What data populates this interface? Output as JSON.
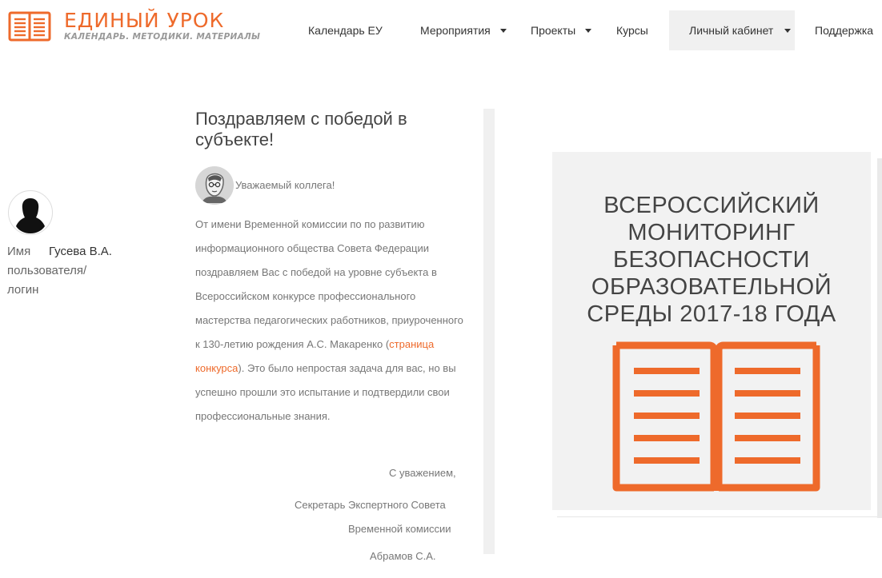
{
  "colors": {
    "accent": "#ee6a2b",
    "nav_active_bg": "#f0f0f0",
    "banner_bg": "#f2f2f2"
  },
  "header": {
    "logo": {
      "title": "ЕДИНЫЙ УРОК",
      "subtitle": "КАЛЕНДАРЬ. МЕТОДИКИ. МАТЕРИАЛЫ",
      "icon": "book-icon"
    },
    "nav": [
      {
        "label": "Календарь ЕУ",
        "dropdown": false
      },
      {
        "label": "Мероприятия",
        "dropdown": true
      },
      {
        "label": "Проекты",
        "dropdown": true
      },
      {
        "label": "Курсы",
        "dropdown": false
      },
      {
        "label": "Личный кабинет",
        "dropdown": true,
        "active": true
      },
      {
        "label": "Поддержка",
        "dropdown": false
      }
    ]
  },
  "user": {
    "avatar_icon": "user-silhouette-icon",
    "label": "Имя пользователя/ логин",
    "value": "Гусева В.А."
  },
  "article": {
    "title": "Поздравляем с победой в субъекте!",
    "author_icon": "portrait-icon",
    "greeting": "Уважаемый коллега!",
    "body_before_link": "От имени Временной комиссии по по развитию информационного общества Совета Федерации поздравляем Вас с победой на уровне субъекта в Всероссийском конкурсе профессионального мастерства педагогических работников, приуроченного к 130-летию рождения А.С. Макаренко (",
    "link_text": "страница конкурса",
    "body_after_link": "). Это было непростая задача для вас, но вы успешно прошли это испытание и подтвердили свои профессиональные знания.",
    "regards": "С уважением,",
    "sign_line1": "Секретарь Экспертного Совета",
    "sign_line2": "Временной комиссии",
    "sign_name": "Абрамов С.А."
  },
  "banner": {
    "title": "ВСЕРОССИЙСКИЙ МОНИТОРИНГ БЕЗОПАСНОСТИ ОБРАЗОВАТЕЛЬНОЙ СРЕДЫ 2017-18 ГОДА",
    "icon": "open-book-icon"
  }
}
